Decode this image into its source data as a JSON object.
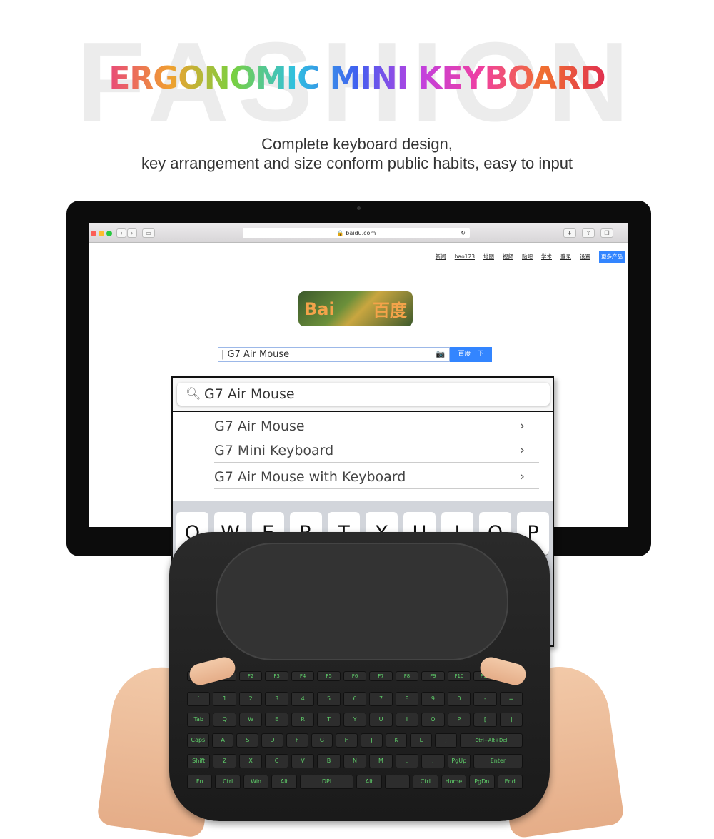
{
  "background_word": "FASHION",
  "title": "ERGONOMIC  MINI KEYBOARD",
  "subtitle_line1": "Complete keyboard design,",
  "subtitle_line2": "key arrangement and size conform public habits, easy to input",
  "browser": {
    "url": "baidu.com",
    "nav": [
      "新闻",
      "hao123",
      "地图",
      "视频",
      "贴吧",
      "学术",
      "登录",
      "设置"
    ],
    "nav_more": "更多产品",
    "logo_left": "Bai",
    "logo_right": "百度",
    "search_value": "| G7 Air Mouse",
    "search_button": "百度一下"
  },
  "phone": {
    "search_value": "G7 Air Mouse",
    "suggestions": [
      "G7 Air Mouse",
      "G7 Mini Keyboard",
      "G7 Air Mouse with Keyboard"
    ],
    "keys": [
      "Q",
      "W",
      "E",
      "R",
      "T",
      "Y",
      "U",
      "I",
      "O",
      "P"
    ]
  },
  "device": {
    "rows": [
      [
        "Esc",
        "F1",
        "F2",
        "F3",
        "F4",
        "F5",
        "F6",
        "F7",
        "F8",
        "F9",
        "F10",
        "F11",
        "F12"
      ],
      [
        "`",
        "1",
        "2",
        "3",
        "4",
        "5",
        "6",
        "7",
        "8",
        "9",
        "0",
        "-",
        "="
      ],
      [
        "Tab",
        "Q",
        "W",
        "E",
        "R",
        "T",
        "Y",
        "U",
        "I",
        "O",
        "P",
        "[",
        "]"
      ],
      [
        "Caps",
        "A",
        "S",
        "D",
        "F",
        "G",
        "H",
        "J",
        "K",
        "L",
        ";",
        "Ctrl+Alt+Del"
      ],
      [
        "Shift",
        "Z",
        "X",
        "C",
        "V",
        "B",
        "N",
        "M",
        ",",
        ".",
        "PgUp",
        "Enter"
      ],
      [
        "Fn",
        "Ctrl",
        "Win",
        "Alt",
        "DPI",
        "Alt",
        "",
        "Ctrl",
        "Home",
        "PgDn",
        "End"
      ]
    ]
  },
  "colors": {
    "accent": "#3385ff",
    "key_text": "#5fd06a"
  }
}
